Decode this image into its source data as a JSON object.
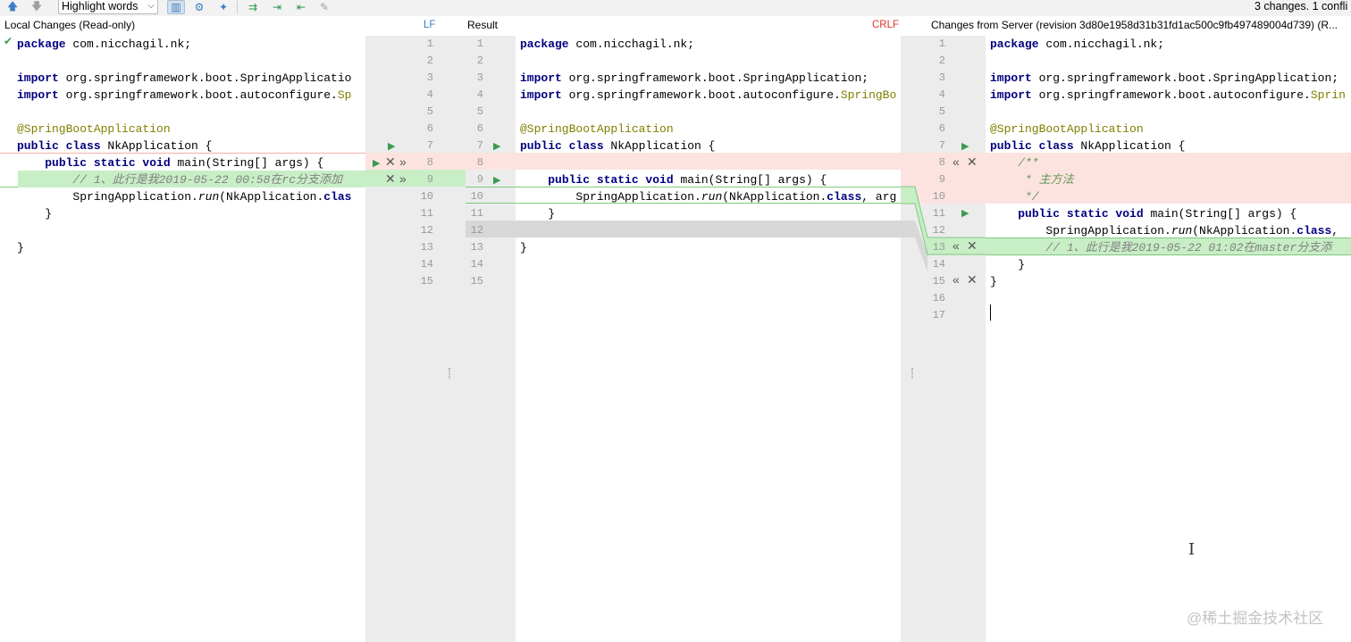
{
  "toolbar": {
    "highlight_select": "Highlight words",
    "status": "3 changes. 1 confli"
  },
  "left_panel": {
    "title": "Local Changes (Read-only)",
    "line_sep": "LF"
  },
  "middle_panel": {
    "title": "Result",
    "line_sep": "CRLF"
  },
  "right_panel": {
    "title": "Changes from Server (revision 3d80e1958d31b31fd1ac500c9fb497489004d739) (R..."
  },
  "left_code": [
    "package com.nicchagil.nk;",
    "",
    "import org.springframework.boot.SpringApplicatio",
    "import org.springframework.boot.autoconfigure.Sp",
    "",
    "@SpringBootApplication",
    "public class NkApplication {",
    "    public static void main(String[] args) {",
    "        // 1、此行是我2019-05-22 00:58在rc分支添加",
    "        SpringApplication.run(NkApplication.clas",
    "    }",
    "",
    "}"
  ],
  "left_line_numbers": [
    "1",
    "2",
    "3",
    "4",
    "5",
    "6",
    "7",
    "8",
    "9",
    "10",
    "11",
    "12",
    "13",
    "14",
    "15"
  ],
  "result_code": [
    "package com.nicchagil.nk;",
    "",
    "import org.springframework.boot.SpringApplication;",
    "import org.springframework.boot.autoconfigure.SpringBo",
    "",
    "@SpringBootApplication",
    "public class NkApplication {",
    "",
    "    public static void main(String[] args) {",
    "        SpringApplication.run(NkApplication.class, arg",
    "    }",
    "",
    "}"
  ],
  "result_line_numbers": [
    "1",
    "2",
    "3",
    "4",
    "5",
    "6",
    "7",
    "8",
    "9",
    "10",
    "11",
    "12",
    "13",
    "14",
    "15"
  ],
  "right_code": [
    "package com.nicchagil.nk;",
    "",
    "import org.springframework.boot.SpringApplication;",
    "import org.springframework.boot.autoconfigure.Sprin",
    "",
    "@SpringBootApplication",
    "public class NkApplication {",
    "    /**",
    "     * 主方法",
    "     */",
    "    public static void main(String[] args) {",
    "        SpringApplication.run(NkApplication.class,",
    "        // 1、此行是我2019-05-22 01:02在master分支添",
    "    }",
    "}",
    "",
    ""
  ],
  "right_line_numbers": [
    "1",
    "2",
    "3",
    "4",
    "5",
    "6",
    "7",
    "8",
    "9",
    "10",
    "11",
    "12",
    "13",
    "14",
    "15",
    "16",
    "17"
  ],
  "colors": {
    "conflict_red": "#fce3e0",
    "added_green": "#c8eec6",
    "gutter_bg": "#ececec",
    "keyword": "#000080",
    "annotation": "#808000",
    "comment": "#808080"
  },
  "watermark": "@稀土掘金技术社区"
}
